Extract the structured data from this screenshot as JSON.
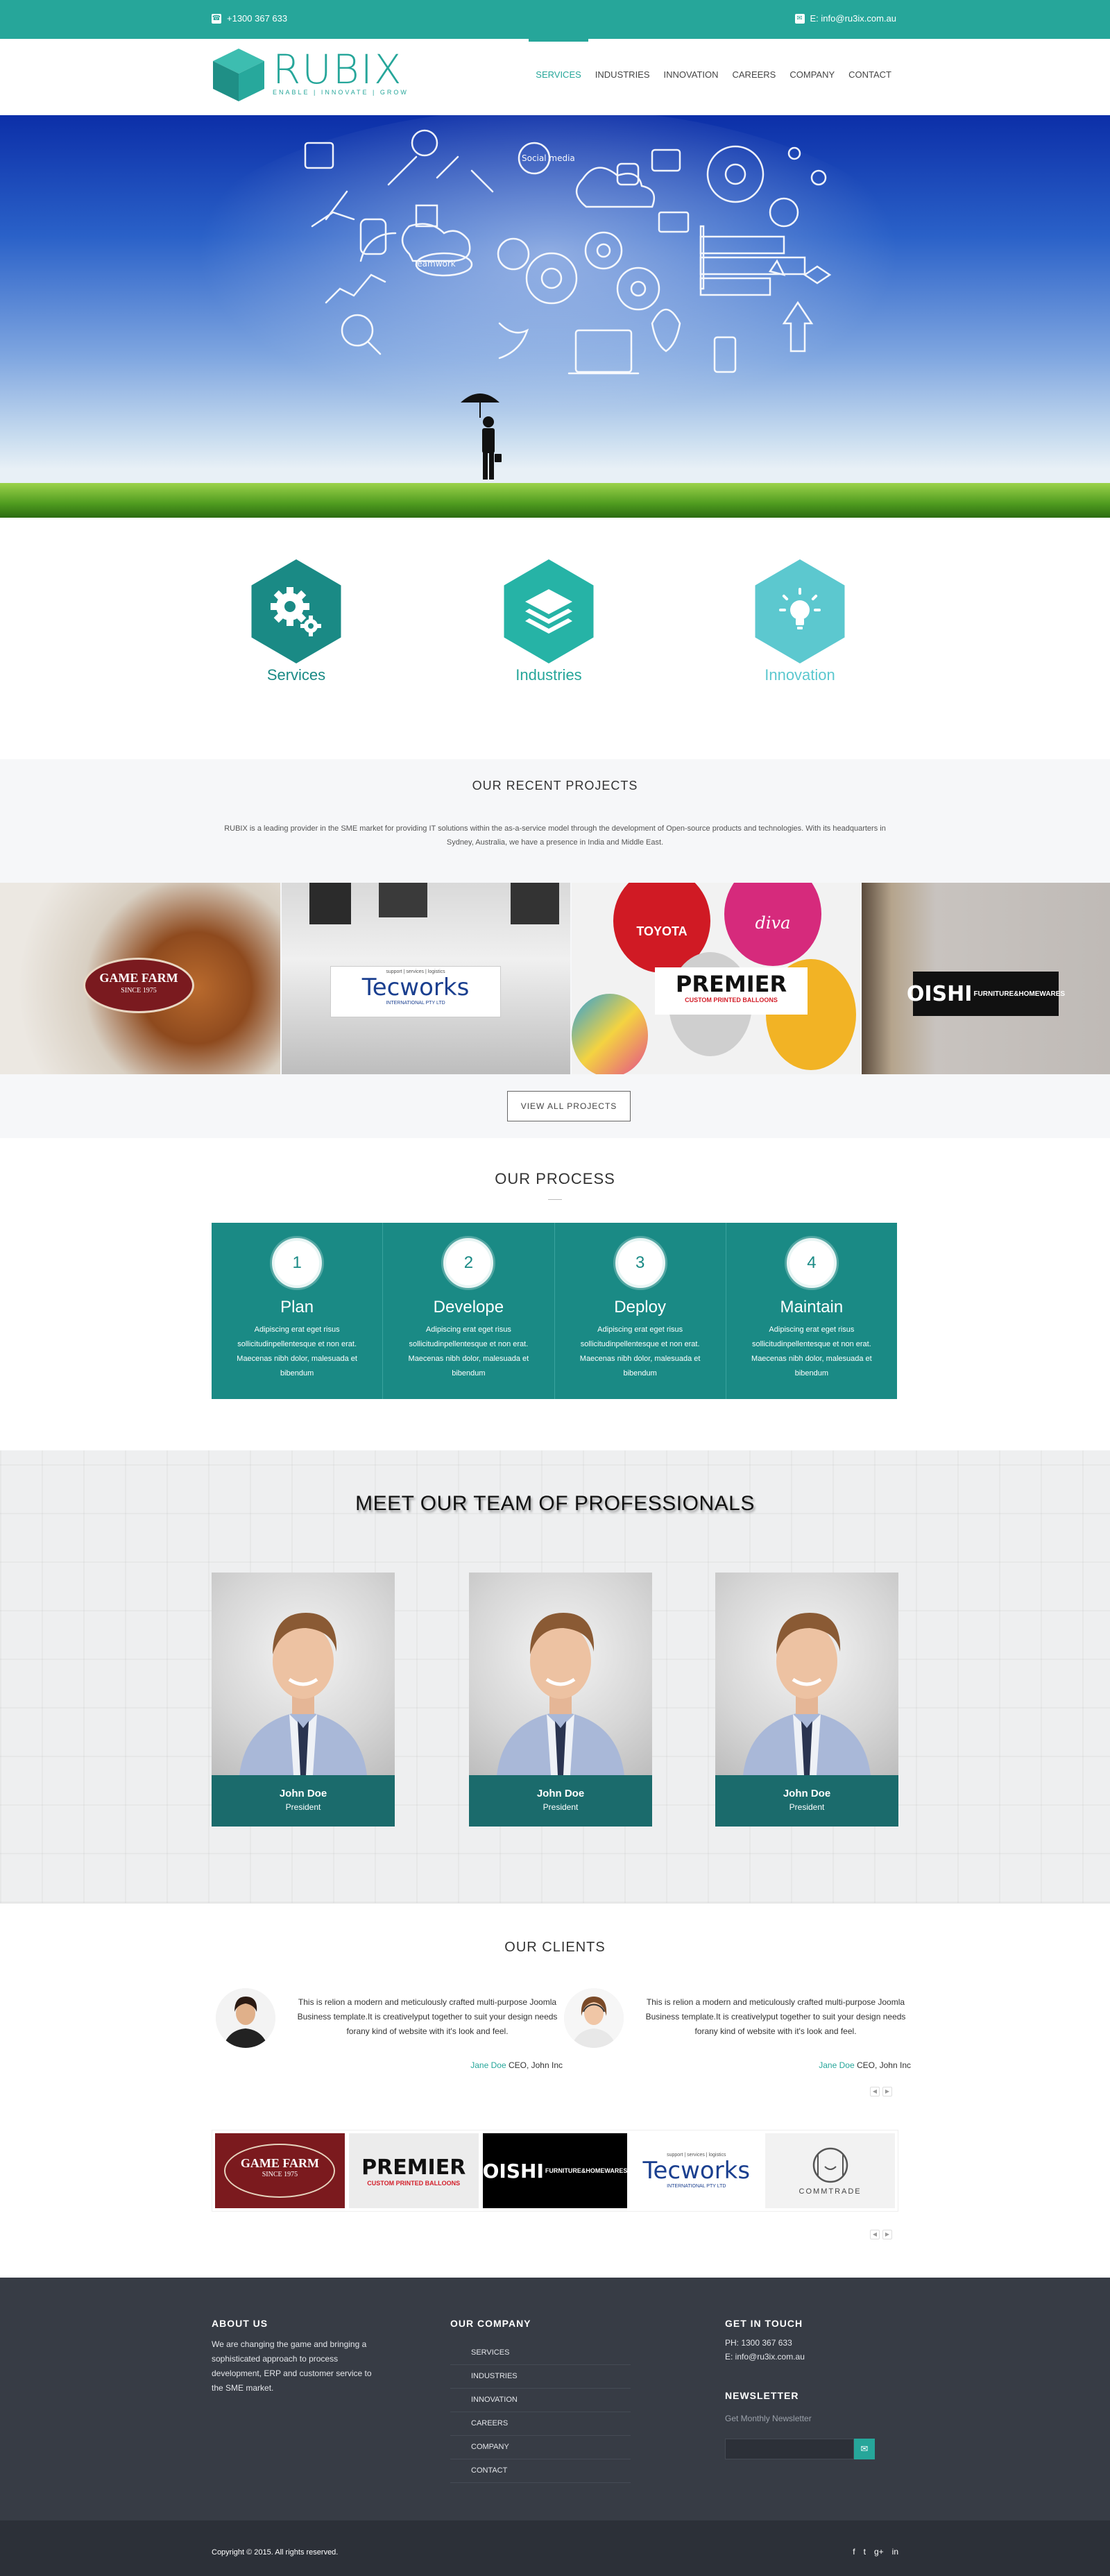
{
  "topbar": {
    "phone": "+1300 367 633",
    "email": "E: info@ru3ix.com.au"
  },
  "brand": {
    "name": "RUBIX",
    "tagline": "ENABLE | INNOVATE | GROW",
    "color": "#26a69a"
  },
  "nav": {
    "items": [
      "SERVICES",
      "INDUSTRIES",
      "INNOVATION",
      "CAREERS",
      "COMPANY",
      "CONTACT"
    ],
    "active": "SERVICES"
  },
  "hero": {
    "doodles": [
      "Social media",
      "Teamwork"
    ]
  },
  "features": [
    {
      "label": "Services",
      "icon": "gears-icon",
      "color": "#1a8a85"
    },
    {
      "label": "Industries",
      "icon": "layers-icon",
      "color": "#26b3a6"
    },
    {
      "label": "Innovation",
      "icon": "lightbulb-icon",
      "color": "#5cc8cf"
    }
  ],
  "projects": {
    "title": "OUR RECENT PROJECTS",
    "description": "RUBIX is a leading provider in the SME market for providing IT solutions within the as-a-service model through the development of Open-source products and technologies. With its headquarters in Sydney, Australia, we have a presence in India and Middle East.",
    "items": [
      {
        "name": "GAME FARM",
        "sub": "SINCE 1975"
      },
      {
        "name": "Tecworks",
        "sub": "INTERNATIONAL PTY LTD",
        "top": "support | services | logistics"
      },
      {
        "name": "PREMIER",
        "sub": "CUSTOM PRINTED BALLOONS",
        "extra1": "TOYOTA",
        "extra2": "diva"
      },
      {
        "name": "OISHI",
        "sub": "FURNITURE&HOMEWARES"
      }
    ],
    "button": "VIEW ALL PROJECTS"
  },
  "process": {
    "title": "OUR PROCESS",
    "steps": [
      {
        "num": "1",
        "title": "Plan",
        "text": "Adipiscing erat eget risus sollicitudinpellentesque et non erat. Maecenas nibh dolor, malesuada et bibendum"
      },
      {
        "num": "2",
        "title": "Develope",
        "text": "Adipiscing erat eget risus sollicitudinpellentesque et non erat. Maecenas nibh dolor, malesuada et bibendum"
      },
      {
        "num": "3",
        "title": "Deploy",
        "text": "Adipiscing erat eget risus sollicitudinpellentesque et non erat. Maecenas nibh dolor, malesuada et bibendum"
      },
      {
        "num": "4",
        "title": "Maintain",
        "text": "Adipiscing erat eget risus sollicitudinpellentesque et non erat. Maecenas nibh dolor, malesuada et bibendum"
      }
    ]
  },
  "team": {
    "title": "MEET OUR TEAM OF PROFESSIONALS",
    "members": [
      {
        "name": "John Doe",
        "role": "President"
      },
      {
        "name": "John Doe",
        "role": "President"
      },
      {
        "name": "John Doe",
        "role": "President"
      }
    ]
  },
  "clients": {
    "title": "OUR CLIENTS",
    "testimonials": [
      {
        "text": "This is relion a modern and meticulously crafted multi-purpose Joomla Business template.It is creativelyput together to suit your design needs forany kind of website with it's look and feel.",
        "author": "Jane Doe",
        "company": " CEO, John Inc"
      },
      {
        "text": "This is relion a modern and meticulously crafted multi-purpose Joomla Business template.It is creativelyput together to suit your design needs forany kind of website with it's look and feel.",
        "author": "Jane Doe",
        "company": " CEO, John Inc"
      }
    ],
    "logos": [
      {
        "name": "GAME FARM",
        "sub": "SINCE 1975"
      },
      {
        "name": "PREMIER",
        "sub": "CUSTOM PRINTED BALLOONS"
      },
      {
        "name": "OISHI",
        "sub": "FURNITURE&HOMEWARES"
      },
      {
        "name": "Tecworks",
        "sub": "INTERNATIONAL PTY LTD",
        "top": "support | services | logistics"
      },
      {
        "name": "COMMTRADE",
        "sub": ""
      }
    ]
  },
  "footer": {
    "about": {
      "title": "ABOUT US",
      "text": "We are changing the game and bringing a sophisticated approach to process development, ERP and customer service to the SME market."
    },
    "company": {
      "title": "OUR COMPANY",
      "links": [
        "SERVICES",
        "INDUSTRIES",
        "INNOVATION",
        "CAREERS",
        "COMPANY",
        "CONTACT"
      ]
    },
    "contact": {
      "title": "GET IN TOUCH",
      "phone": "PH: 1300 367 633",
      "email": "E: info@ru3ix.com.au"
    },
    "newsletter": {
      "title": "NEWSLETTER",
      "subtitle": "Get Monthly Newsletter",
      "placeholder": "",
      "button_icon": "mail-icon"
    },
    "copyright": "Copyright © 2015. All rights reserved.",
    "socials": [
      "f",
      "t",
      "g+",
      "in"
    ]
  }
}
